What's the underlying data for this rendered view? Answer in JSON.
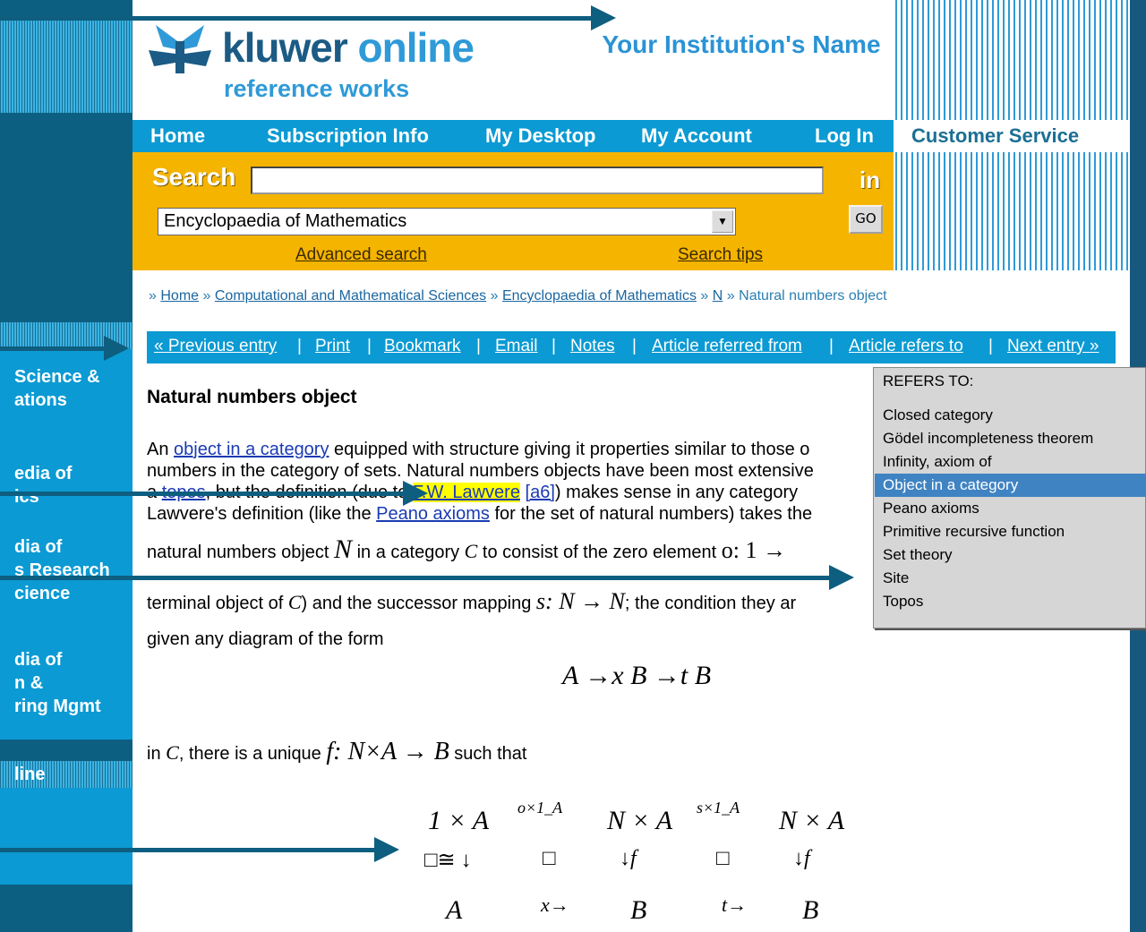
{
  "brand": {
    "title_a": "kluwer",
    "title_b": "online",
    "subtitle": "reference works"
  },
  "institution": {
    "name": "Your Institution's Name"
  },
  "sidebar": {
    "items": [
      {
        "label": "Science &\nations"
      },
      {
        "label": "edia of\nics"
      },
      {
        "label": "dia of\ns Research\ncience"
      },
      {
        "label": "dia of\nn &\nring Mgmt"
      },
      {
        "label": "line"
      }
    ]
  },
  "top_nav": {
    "home": "Home",
    "subscription": "Subscription Info",
    "desktop": "My Desktop",
    "account": "My Account",
    "login": "Log In",
    "customer_service": "Customer Service"
  },
  "search": {
    "label": "Search",
    "in_label": "in",
    "value": "",
    "scope": "Encyclopaedia of Mathematics",
    "go": "GO",
    "advanced": "Advanced search",
    "tips": "Search tips"
  },
  "breadcrumb": {
    "sep": "»",
    "home": "Home",
    "cms": "Computational and Mathematical Sciences",
    "eom": "Encyclopaedia of Mathematics",
    "n": "N",
    "current": "Natural numbers object"
  },
  "entry_bar": {
    "prev": "« Previous entry",
    "print": "Print",
    "bookmark": "Bookmark",
    "email": "Email",
    "notes": "Notes",
    "referred_from": "Article referred from",
    "refers_to": "Article refers to",
    "next": "Next entry »",
    "sep": "|"
  },
  "article": {
    "title": "Natural numbers object",
    "p1_a": "An ",
    "p1_link": "object in a category",
    "p1_b": " equipped with structure giving it properties similar to those o",
    "p2": "numbers in the category of sets. Natural numbers objects have been most extensive",
    "p3_a": "a ",
    "p3_link": "topos",
    "p3_b": ", but the definition (due to ",
    "p3_hl": "F.W. Lawvere",
    "p3_c": " ",
    "p3_ref": "[a6]",
    "p3_d": ") makes sense in any category",
    "p4_a": "Lawvere's definition (like the ",
    "p4_link": "Peano axioms",
    "p4_b": " for the set of natural numbers) takes the",
    "p5_a": "natural numbers object ",
    "p5_N": "N",
    "p5_b": " in a category ",
    "p5_C": "C",
    "p5_c": " to consist of the zero element ",
    "p5_o": "o: 1 →",
    "p6_a": "terminal object of ",
    "p6_C": "C",
    "p6_b": ") and the successor mapping ",
    "p6_s": "s: N → N",
    "p6_c": "; the condition they ar",
    "p7": "given any diagram of the form",
    "eq1": "A →x B →t B",
    "p8_a": "in ",
    "p8_C": "C",
    "p8_b": ", there is a unique ",
    "p8_f": "f: N×A → B",
    "p8_c": " such that"
  },
  "diagram": {
    "row1": [
      "1 × A",
      "o×1_A",
      "N × A",
      "s×1_A",
      "N × A"
    ],
    "row2": [
      "□≅ ↓",
      "□",
      "↓f",
      "□",
      "↓f"
    ],
    "row3": [
      "A",
      "x→",
      "B",
      "t→",
      "B"
    ]
  },
  "refers_popup": {
    "header": "REFERS TO:",
    "items": [
      "Closed category",
      "Gödel incompleteness theorem",
      "Infinity, axiom of",
      "Object in a category",
      "Peano axioms",
      "Primitive recursive function",
      "Set theory",
      "Site",
      "Topos"
    ],
    "selected": "Object in a category"
  },
  "colors": {
    "nav_blue": "#0b9ad3",
    "search_gold": "#f5b400",
    "link": "#1a3bb3",
    "arrow": "#0e5e80"
  }
}
